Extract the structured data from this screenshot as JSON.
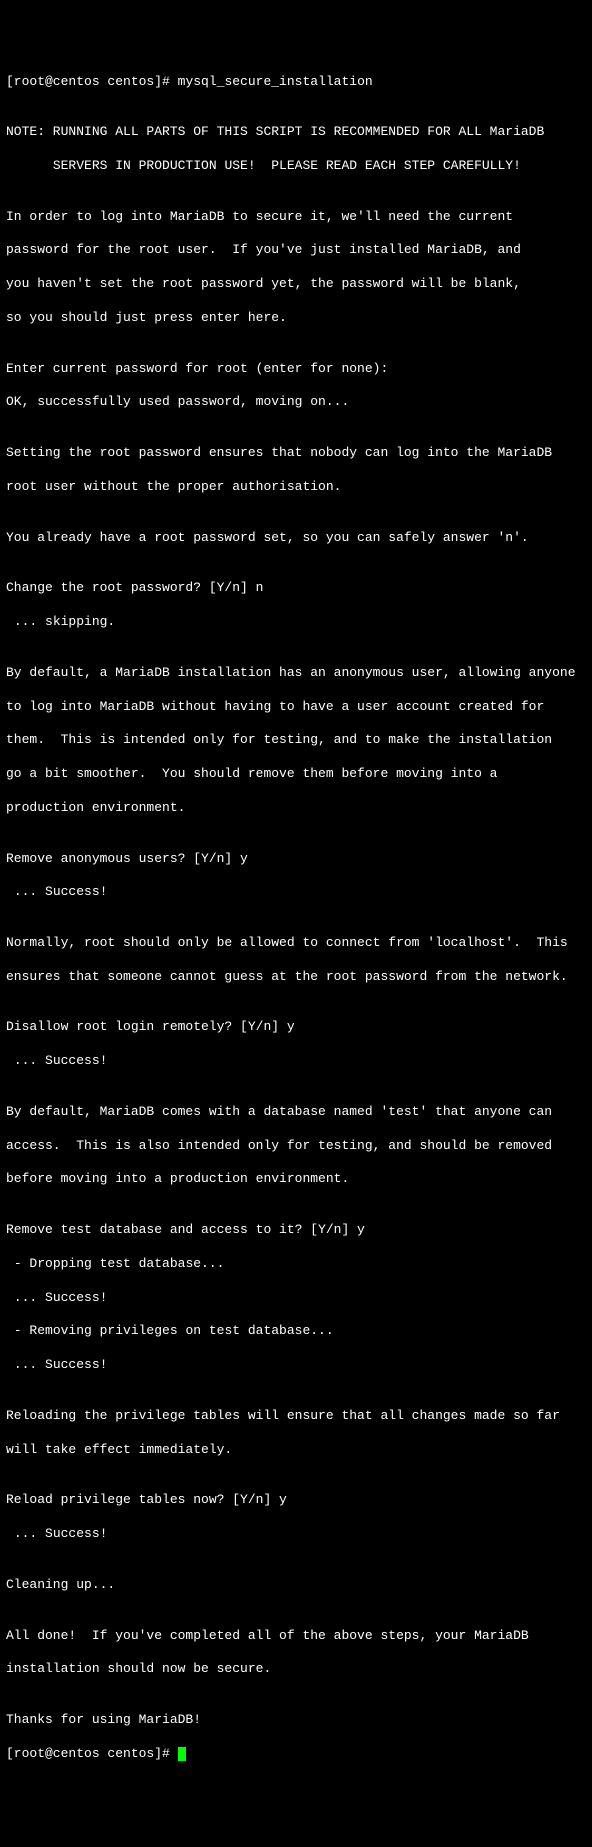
{
  "terminal": {
    "prompt1": "[root@centos centos]# ",
    "command1": "mysql_secure_installation",
    "blank": "",
    "note1": "NOTE: RUNNING ALL PARTS OF THIS SCRIPT IS RECOMMENDED FOR ALL MariaDB",
    "note2": "      SERVERS IN PRODUCTION USE!  PLEASE READ EACH STEP CAREFULLY!",
    "intro1": "In order to log into MariaDB to secure it, we'll need the current",
    "intro2": "password for the root user.  If you've just installed MariaDB, and",
    "intro3": "you haven't set the root password yet, the password will be blank,",
    "intro4": "so you should just press enter here.",
    "enterpw": "Enter current password for root (enter for none):",
    "okpw": "OK, successfully used password, moving on...",
    "setpw1": "Setting the root password ensures that nobody can log into the MariaDB",
    "setpw2": "root user without the proper authorisation.",
    "already": "You already have a root password set, so you can safely answer 'n'.",
    "changepw": "Change the root password? [Y/n] n",
    "skipping": " ... skipping.",
    "anon1": "By default, a MariaDB installation has an anonymous user, allowing anyone",
    "anon2": "to log into MariaDB without having to have a user account created for",
    "anon3": "them.  This is intended only for testing, and to make the installation",
    "anon4": "go a bit smoother.  You should remove them before moving into a",
    "anon5": "production environment.",
    "removeanon": "Remove anonymous users? [Y/n] y",
    "success1": " ... Success!",
    "remote1": "Normally, root should only be allowed to connect from 'localhost'.  This",
    "remote2": "ensures that someone cannot guess at the root password from the network.",
    "disallow": "Disallow root login remotely? [Y/n] y",
    "success2": " ... Success!",
    "test1": "By default, MariaDB comes with a database named 'test' that anyone can",
    "test2": "access.  This is also intended only for testing, and should be removed",
    "test3": "before moving into a production environment.",
    "removetest": "Remove test database and access to it? [Y/n] y",
    "dropping": " - Dropping test database...",
    "success3": " ... Success!",
    "removepriv": " - Removing privileges on test database...",
    "success4": " ... Success!",
    "reload1": "Reloading the privilege tables will ensure that all changes made so far",
    "reload2": "will take effect immediately.",
    "reloadq": "Reload privilege tables now? [Y/n] y",
    "success5": " ... Success!",
    "cleanup": "Cleaning up...",
    "done1": "All done!  If you've completed all of the above steps, your MariaDB",
    "done2": "installation should now be secure.",
    "thanks": "Thanks for using MariaDB!",
    "prompt2": "[root@centos centos]# "
  }
}
